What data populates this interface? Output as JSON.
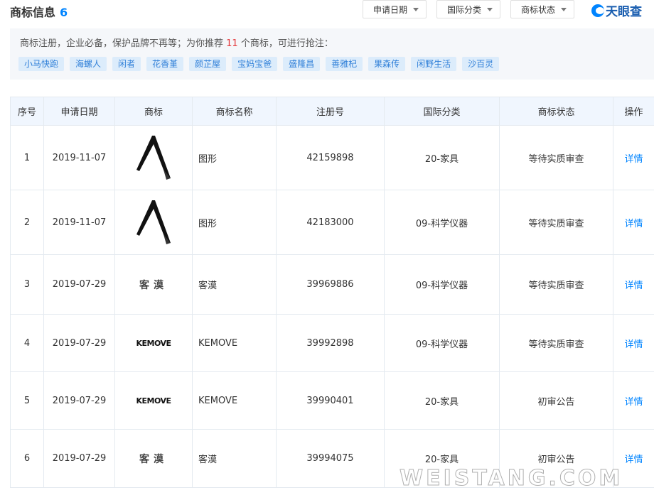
{
  "header": {
    "title": "商标信息",
    "count": "6",
    "filters": [
      "申请日期",
      "国际分类",
      "商标状态"
    ],
    "logo_text": "天眼查"
  },
  "promo": {
    "text_before": "商标注册，企业必备，保护品牌不再等；为你推荐",
    "highlight": "11",
    "text_after": "个商标，可进行抢注：",
    "tags": [
      "小马快跑",
      "海螺人",
      "闲者",
      "花香堇",
      "颜芷屋",
      "宝妈宝爸",
      "盛隆昌",
      "善雅杞",
      "果森传",
      "闲野生活",
      "沙百灵"
    ]
  },
  "table": {
    "headers": [
      "序号",
      "申请日期",
      "商标",
      "商标名称",
      "注册号",
      "国际分类",
      "商标状态",
      "操作"
    ],
    "rows": [
      {
        "index": "1",
        "date": "2019-11-07",
        "mark_type": "image",
        "mark_text": "",
        "name": "图形",
        "reg_no": "42159898",
        "class": "20-家具",
        "status": "等待实质审查",
        "action": "详情"
      },
      {
        "index": "2",
        "date": "2019-11-07",
        "mark_type": "image",
        "mark_text": "",
        "name": "图形",
        "reg_no": "42183000",
        "class": "09-科学仪器",
        "status": "等待实质审查",
        "action": "详情"
      },
      {
        "index": "3",
        "date": "2019-07-29",
        "mark_type": "text",
        "mark_text": "客漠",
        "name": "客漠",
        "reg_no": "39969886",
        "class": "09-科学仪器",
        "status": "等待实质审查",
        "action": "详情"
      },
      {
        "index": "4",
        "date": "2019-07-29",
        "mark_type": "brand",
        "mark_text": "KEMOVE",
        "name": "KEMOVE",
        "reg_no": "39992898",
        "class": "09-科学仪器",
        "status": "等待实质审查",
        "action": "详情"
      },
      {
        "index": "5",
        "date": "2019-07-29",
        "mark_type": "brand",
        "mark_text": "KEMOVE",
        "name": "KEMOVE",
        "reg_no": "39990401",
        "class": "20-家具",
        "status": "初审公告",
        "action": "详情"
      },
      {
        "index": "6",
        "date": "2019-07-29",
        "mark_type": "text",
        "mark_text": "客漠",
        "name": "客漠",
        "reg_no": "39994075",
        "class": "20-家具",
        "status": "初审公告",
        "action": "详情"
      }
    ]
  },
  "watermark": "WEISTANG.COM"
}
